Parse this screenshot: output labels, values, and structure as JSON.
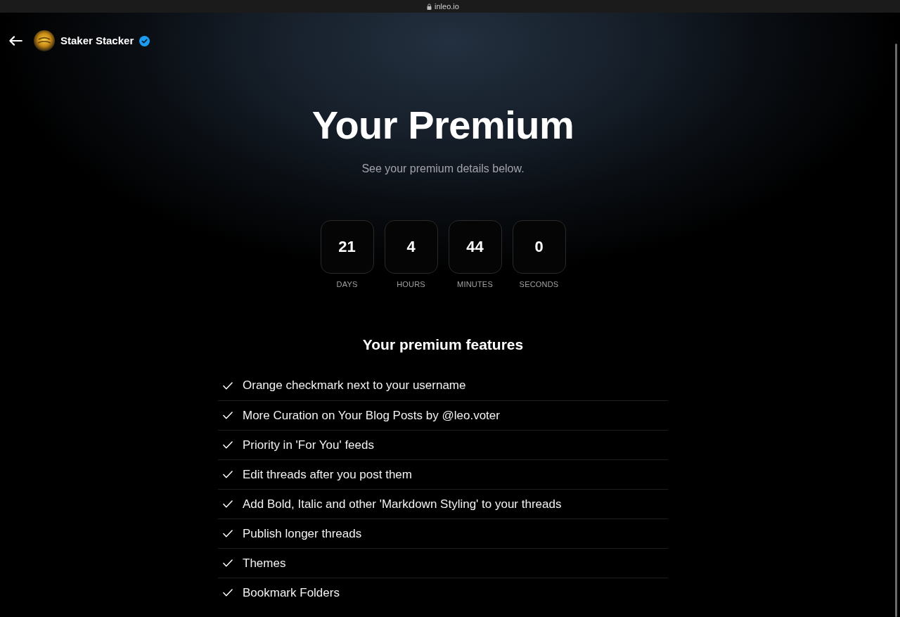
{
  "browser_bar": {
    "address": "inleo.io"
  },
  "profile": {
    "name": "Staker Stacker",
    "verified": true
  },
  "hero": {
    "title": "Your Premium",
    "subtitle": "See your premium details below."
  },
  "countdown": [
    {
      "value": "21",
      "label": "DAYS"
    },
    {
      "value": "4",
      "label": "HOURS"
    },
    {
      "value": "44",
      "label": "MINUTES"
    },
    {
      "value": "0",
      "label": "SECONDS"
    }
  ],
  "features": {
    "heading": "Your premium features",
    "items": [
      "Orange checkmark next to your username",
      "More Curation on Your Blog Posts by @leo.voter",
      "Priority in 'For You' feeds",
      "Edit threads after you post them",
      "Add Bold, Italic and other 'Markdown Styling' to your threads",
      "Publish longer threads",
      "Themes",
      "Bookmark Folders"
    ]
  }
}
